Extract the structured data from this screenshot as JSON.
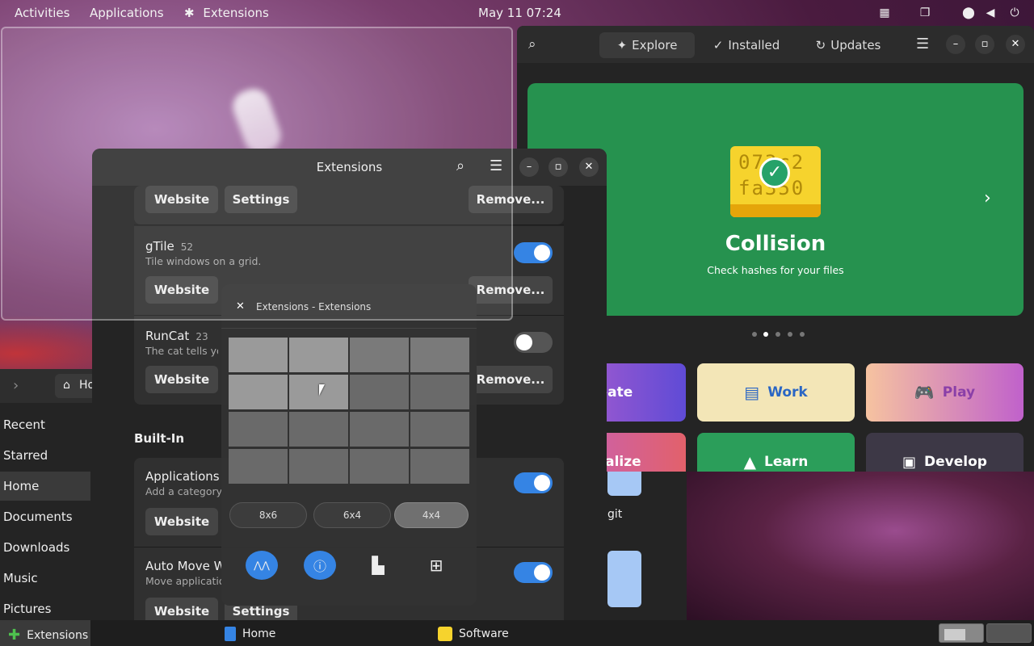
{
  "topbar": {
    "activities": "Activities",
    "applications": "Applications",
    "extensions": "Extensions",
    "clock": "May 11  07:24"
  },
  "files": {
    "path_home": "Home",
    "sidebar": [
      "Recent",
      "Starred",
      "Home",
      "Documents",
      "Downloads",
      "Music",
      "Pictures"
    ],
    "folder_label": "git"
  },
  "software": {
    "tabs": [
      "Explore",
      "Installed",
      "Updates"
    ],
    "banner": {
      "title": "Collision",
      "subtitle": "Check hashes for your files",
      "hash_top": "073c2",
      "hash_bottom": "fa350"
    },
    "categories": [
      "Create",
      "Work",
      "Play",
      "Socialize",
      "Learn",
      "Develop"
    ],
    "category_colors": {
      "create": "#7d44c8",
      "work": "#f3e6b7",
      "play": "#e9a89b",
      "socialize": "#e2616b",
      "learn": "#2b9e5a",
      "develop": "#3d3846"
    }
  },
  "extensions": {
    "title": "Extensions",
    "website": "Website",
    "settings": "Settings",
    "remove": "Remove...",
    "items": [
      {
        "name": "gTile",
        "version": "52",
        "desc": "Tile windows on a grid.",
        "enabled": true
      },
      {
        "name": "RunCat",
        "version": "23",
        "desc": "The cat tells you the CPU usage",
        "enabled": false
      }
    ],
    "builtin_heading": "Built-In",
    "builtin": [
      {
        "name": "Applications Menu",
        "desc": "Add a category-based menu for applications",
        "enabled": true
      },
      {
        "name": "Auto Move Windows",
        "desc": "Move applications to specific workspaces",
        "enabled": true
      }
    ]
  },
  "gtile": {
    "title": "Extensions - Extensions",
    "presets": [
      "8x6",
      "6x4",
      "4x4"
    ],
    "selected_preset": "4x4"
  },
  "taskbar": {
    "items": [
      "Extensions",
      "Home",
      "Software"
    ]
  },
  "colors": {
    "accent": "#3584e4",
    "banner": "#26924f"
  }
}
